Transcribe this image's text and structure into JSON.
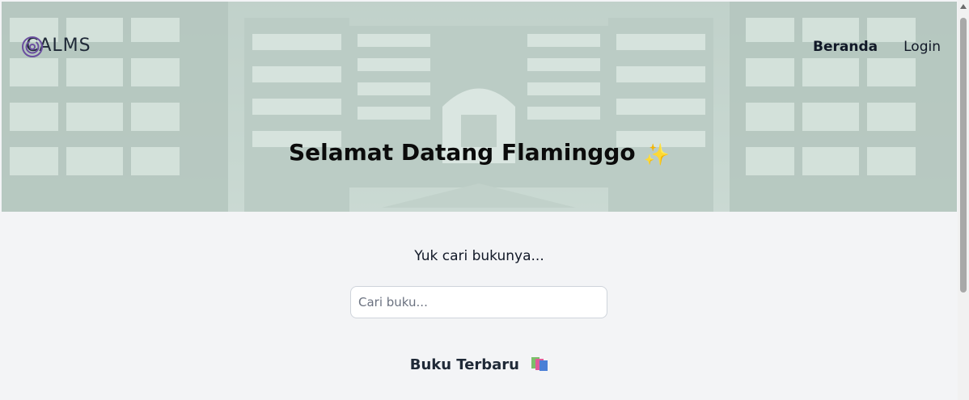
{
  "brand": {
    "name": "CALMS",
    "logo_icon": "spiral-logo-icon"
  },
  "nav": {
    "items": [
      {
        "label": "Beranda",
        "active": true
      },
      {
        "label": "Login",
        "active": false
      }
    ]
  },
  "hero": {
    "title": "Selamat Datang Flaminggo",
    "title_icon": "sparkles-icon",
    "background": "library-bookshelves"
  },
  "search": {
    "label": "Yuk cari bukunya...",
    "placeholder": "Cari buku...",
    "value": ""
  },
  "latest": {
    "title": "Buku Terbaru",
    "title_icon": "books-icon"
  },
  "colors": {
    "page_bg": "#f3f4f6",
    "hero_tint": "#cddfd6",
    "text": "#111827",
    "sparkle": "#f5b93b"
  }
}
